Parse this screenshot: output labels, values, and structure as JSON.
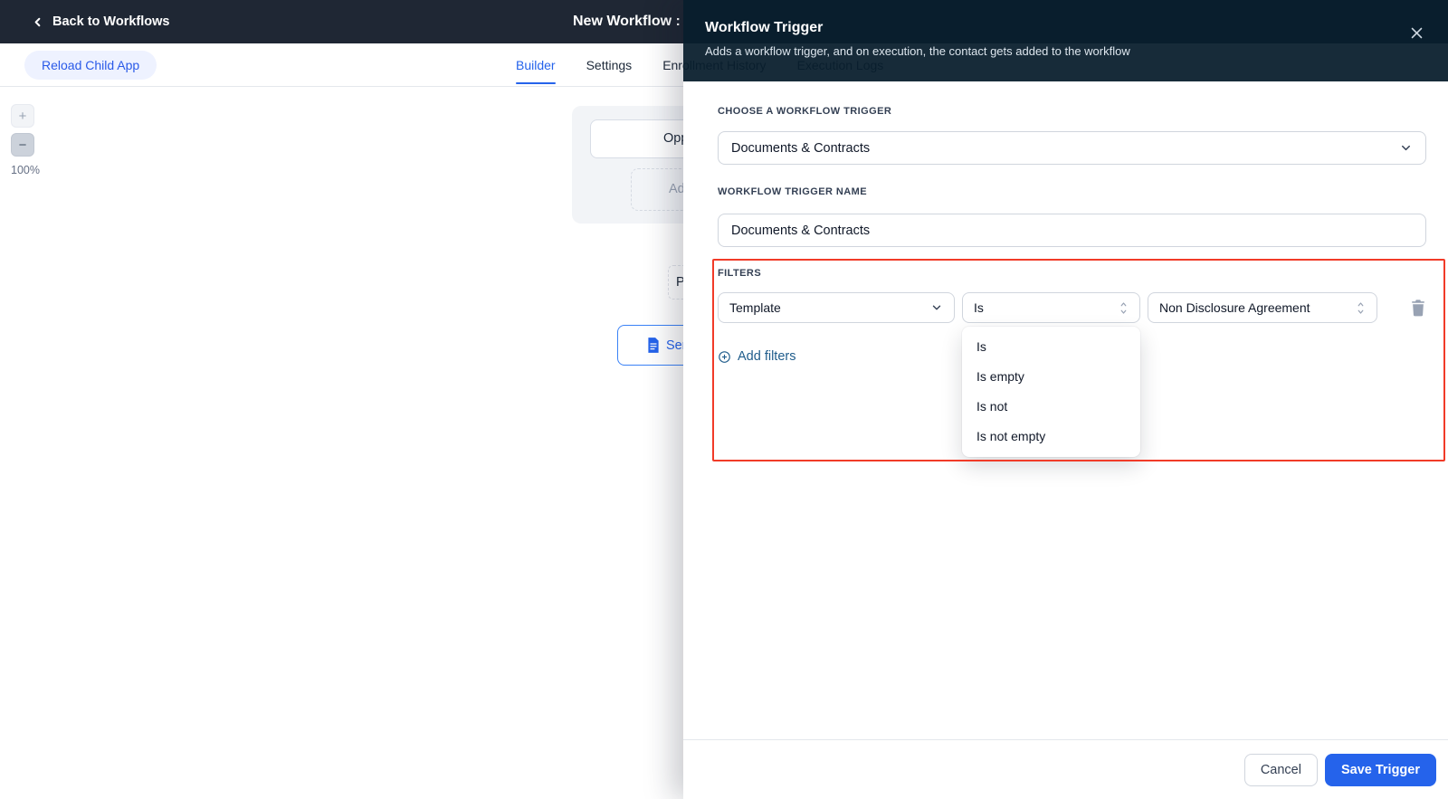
{
  "navbar": {
    "back_label": "Back to Workflows",
    "title": "New Workflow :"
  },
  "tabbar": {
    "reload_label": "Reload Child App",
    "tabs": [
      {
        "label": "Builder",
        "active": true
      },
      {
        "label": "Settings",
        "active": false
      },
      {
        "label": "Enrollment History",
        "active": false
      },
      {
        "label": "Execution Logs",
        "active": false
      }
    ]
  },
  "canvas": {
    "zoom_in": "+",
    "zoom_out": "−",
    "zoom_level": "100%",
    "opportunity_node_fragment": "Oppor",
    "add_node_fragment": "Add N",
    "placeholder_fragment": "Pl",
    "send_button_fragment": "Send"
  },
  "panel": {
    "title": "Workflow Trigger",
    "subtitle": "Adds a workflow trigger, and on execution, the contact gets added to the workflow",
    "trigger_section": {
      "label": "CHOOSE A WORKFLOW TRIGGER",
      "value": "Documents & Contracts"
    },
    "name_section": {
      "label": "WORKFLOW TRIGGER NAME",
      "value": "Documents & Contracts"
    },
    "filters_section": {
      "label": "FILTERS",
      "filter_row": {
        "field": "Template",
        "operator": "Is",
        "value": "Non Disclosure Agreement"
      },
      "operator_options": [
        "Is",
        "Is empty",
        "Is not",
        "Is not empty"
      ],
      "add_filters_label": "Add filters"
    },
    "footer": {
      "cancel_label": "Cancel",
      "save_label": "Save Trigger"
    }
  },
  "colors": {
    "navbar_bg": "#1f2734",
    "panel_header_bg": "#0e2533",
    "accent_blue": "#2563eb",
    "add_filters_blue": "#205d8c",
    "annotation_red": "#f13b28",
    "border_gray": "#d0d5dd",
    "label_gray": "#344054",
    "icon_gray": "#98a2b3"
  }
}
